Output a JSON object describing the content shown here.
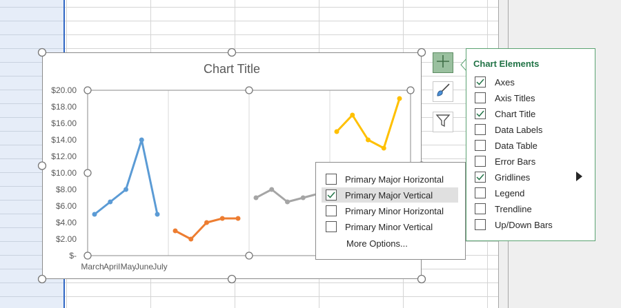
{
  "chart": {
    "title": "Chart Title"
  },
  "chart_data": {
    "type": "line",
    "title": "Chart Title",
    "categories": [
      "March",
      "April",
      "May",
      "June",
      "July"
    ],
    "ylim": [
      0,
      20
    ],
    "y_ticks": [
      "$20.00",
      "$18.00",
      "$16.00",
      "$14.00",
      "$12.00",
      "$10.00",
      "$8.00",
      "$6.00",
      "$4.00",
      "$2.00",
      "$-"
    ],
    "grid": "vertical",
    "series": [
      {
        "color": "#5b9bd5",
        "values": [
          5.0,
          6.5,
          8.0,
          14.0,
          5.0
        ]
      },
      {
        "color": "#ed7d31",
        "values": [
          3.0,
          2.0,
          4.0,
          4.5,
          4.5
        ]
      },
      {
        "color": "#a5a5a5",
        "values": [
          7.0,
          8.0,
          6.5,
          7.0,
          7.5
        ]
      },
      {
        "color": "#ffc000",
        "values": [
          15.0,
          17.0,
          14.0,
          13.0,
          19.0
        ]
      }
    ]
  },
  "side_buttons": {
    "elements_icon": "plus-icon",
    "styles_icon": "brush-icon",
    "filters_icon": "filter-icon"
  },
  "chart_elements": {
    "title": "Chart Elements",
    "items": [
      {
        "label": "Axes",
        "checked": true
      },
      {
        "label": "Axis Titles",
        "checked": false
      },
      {
        "label": "Chart Title",
        "checked": true
      },
      {
        "label": "Data Labels",
        "checked": false
      },
      {
        "label": "Data Table",
        "checked": false
      },
      {
        "label": "Error Bars",
        "checked": false
      },
      {
        "label": "Gridlines",
        "checked": true
      },
      {
        "label": "Legend",
        "checked": false
      },
      {
        "label": "Trendline",
        "checked": false
      },
      {
        "label": "Up/Down Bars",
        "checked": false
      }
    ]
  },
  "gridlines_menu": {
    "items": [
      {
        "label": "Primary Major Horizontal",
        "checked": false
      },
      {
        "label": "Primary Major Vertical",
        "checked": true
      },
      {
        "label": "Primary Minor Horizontal",
        "checked": false
      },
      {
        "label": "Primary Minor Vertical",
        "checked": false
      }
    ],
    "more_options": "More Options..."
  },
  "colors": {
    "accent_green": "#217346",
    "selection_blue": "#2f66c4"
  }
}
